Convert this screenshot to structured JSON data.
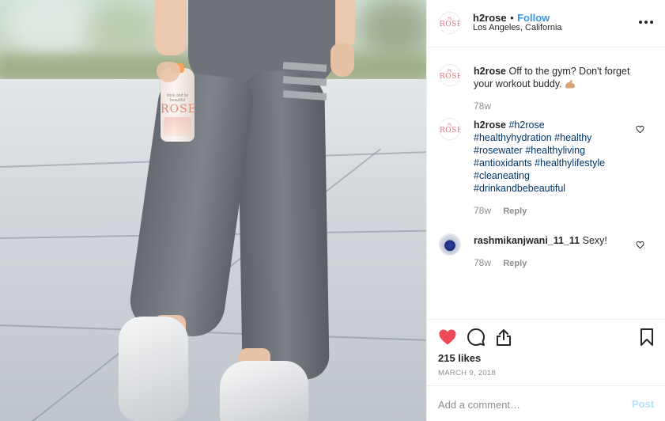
{
  "photo": {
    "bottle_brand": "ROSE",
    "bottle_tagline": "drink and be beautiful"
  },
  "header": {
    "username": "h2rose",
    "separator": "•",
    "follow_label": "Follow",
    "location": "Los Angeles, California",
    "more_icon": "more-horizontal-icon"
  },
  "comments": [
    {
      "username": "h2rose",
      "text": "Off to the gym? Don't forget your workout buddy.",
      "emoji": "flexed-biceps",
      "time": "78w"
    },
    {
      "username": "h2rose",
      "hashtags": [
        "#h2rose",
        "#healthyhydration",
        "#healthy",
        "#rosewater",
        "#healthyliving",
        "#antioxidants",
        "#healthylifestyle",
        "#cleaneating",
        "#drinkandbebeautiful"
      ],
      "time": "78w",
      "reply_label": "Reply"
    },
    {
      "username": "rashmikanjwani_11_11",
      "text": "Sexy!",
      "time": "78w",
      "reply_label": "Reply"
    }
  ],
  "actions": {
    "like_icon": "heart-filled-icon",
    "comment_icon": "comment-icon",
    "share_icon": "share-icon",
    "save_icon": "bookmark-icon",
    "like_color": "#ed4956"
  },
  "likes": "215 likes",
  "date": "March 9, 2018",
  "add_comment": {
    "placeholder": "Add a comment…",
    "post_label": "Post",
    "post_color": "#b2dffc"
  },
  "colors": {
    "link": "#3897f0",
    "hashtag": "#003569",
    "muted": "#8e8e8e",
    "text": "#262626"
  }
}
